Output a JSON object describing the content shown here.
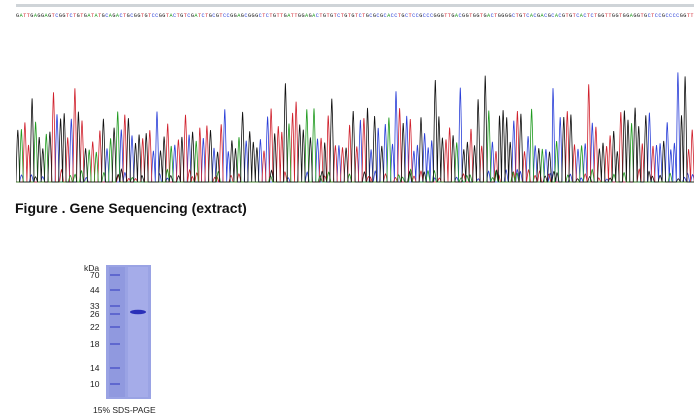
{
  "figure": {
    "caption": "Figure . Gene Sequencing (extract)"
  },
  "sequence": {
    "bases": "GATTGAGGAGTCGGTCTGTGATATGCAGACTGCGGTGTCCGGTACTGTCGATCTGCGTCCGGAGCGGGCTCTGTTGATTGGAGACTGTGTCTGTGTCTGCGCGCACCTGCTCCGCCCGGGTTGACGGTGGTGACTGGGGCTGTCACGACGCACGTGTCACTCTGGTTGGTGGAGGTGCTCCGCCCCGGTT",
    "colors": {
      "A": "#1f9a1f",
      "C": "#2a3fd8",
      "G": "#111111",
      "T": "#d0202c"
    }
  },
  "gel": {
    "unit_label": "kDa",
    "markers": [
      "70",
      "44",
      "33",
      "26",
      "22",
      "18",
      "14",
      "10"
    ],
    "footer": "15% SDS-PAGE",
    "lane_color": "#8c95de",
    "band_color": "#2a2fb8"
  }
}
